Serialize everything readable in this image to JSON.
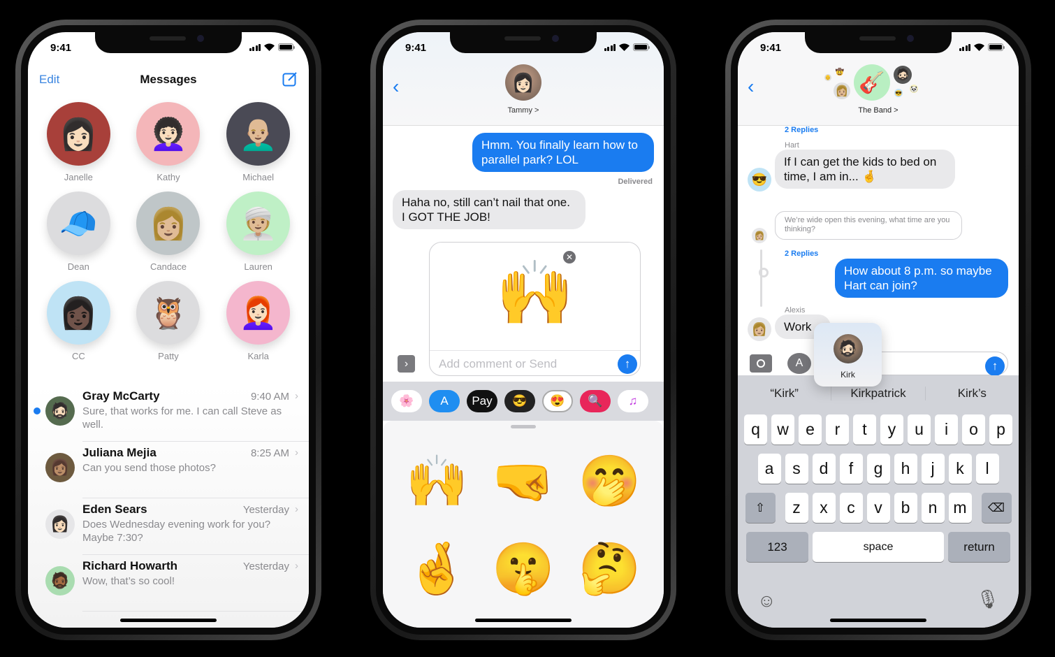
{
  "status_time": "9:41",
  "phone1": {
    "nav": {
      "edit": "Edit",
      "title": "Messages"
    },
    "pinned": [
      {
        "name": "Janelle",
        "icon": "👩🏻",
        "bg": "#a8403a"
      },
      {
        "name": "Kathy",
        "icon": "👩🏻‍🦱",
        "bg": "#f4b6b9"
      },
      {
        "name": "Michael",
        "icon": "👨🏼‍🦲",
        "bg": "#4a4a55"
      },
      {
        "name": "Dean",
        "icon": "🧢",
        "bg": "#dcdcde"
      },
      {
        "name": "Candace",
        "icon": "👩🏼",
        "bg": "#bfc6c8"
      },
      {
        "name": "Lauren",
        "icon": "👳🏼‍♀️",
        "bg": "#bff0c6"
      },
      {
        "name": "CC",
        "icon": "👩🏿",
        "bg": "#bfe3f5"
      },
      {
        "name": "Patty",
        "icon": "🦉",
        "bg": "#dcdcde"
      },
      {
        "name": "Karla",
        "icon": "👩🏻‍🦰",
        "bg": "#f4b6cd"
      }
    ],
    "conversations": [
      {
        "name": "Gray McCarty",
        "time": "9:40 AM",
        "preview": "Sure, that works for me. I can call Steve as well.",
        "unread": true,
        "icon": "🧔🏻",
        "bg": "#556b4f"
      },
      {
        "name": "Juliana Mejia",
        "time": "8:25 AM",
        "preview": "Can you send those photos?",
        "unread": false,
        "icon": "👩🏽",
        "bg": "#6d5a3f"
      },
      {
        "name": "Eden Sears",
        "time": "Yesterday",
        "preview": "Does Wednesday evening work for you? Maybe 7:30?",
        "unread": false,
        "icon": "👩🏻",
        "bg": "#e6e6e8"
      },
      {
        "name": "Richard Howarth",
        "time": "Yesterday",
        "preview": "Wow, that’s so cool!",
        "unread": false,
        "icon": "🧔🏾",
        "bg": "#a9dcb0"
      }
    ]
  },
  "phone2": {
    "contact": "Tammy >",
    "contact_icon": "👩🏻",
    "messages": [
      {
        "dir": "out",
        "text": "Hmm. You finally learn how to parallel park? LOL"
      },
      {
        "dir": "in",
        "text": "Haha no, still can’t nail that one. I GOT THE JOB!"
      }
    ],
    "delivered": "Delivered",
    "draft": {
      "sticker": "🙌",
      "placeholder": "Add comment or Send"
    },
    "apps": [
      {
        "name": "photos",
        "glyph": "🌸",
        "bg": "#ffffff"
      },
      {
        "name": "app-store",
        "glyph": "A",
        "bg": "#1f8ef1"
      },
      {
        "name": "apple-pay",
        "glyph": "Pay",
        "bg": "#111111"
      },
      {
        "name": "memoji",
        "glyph": "😎",
        "bg": "#222222"
      },
      {
        "name": "memoji-stickers",
        "glyph": "😍",
        "bg": "#ffffff"
      },
      {
        "name": "images-search",
        "glyph": "🔍",
        "bg": "#e8265a"
      },
      {
        "name": "music",
        "glyph": "♫",
        "bg": "#ffffff"
      }
    ],
    "stickers": [
      "🙌",
      "🤜",
      "🤭",
      "🤞",
      "🤫",
      "🤔"
    ]
  },
  "phone3": {
    "group": "The Band >",
    "replies_label": "2 Replies",
    "hart": {
      "sender": "Hart",
      "text": "If I can get the kids to bed on time, I am in... 🤞",
      "icon": "😎"
    },
    "quoted": "We’re wide open this evening, what time are you thinking?",
    "out_msg": "How about 8 p.m. so maybe Hart can join?",
    "alexis": {
      "sender": "Alexis",
      "text": "Work",
      "icon": "👩🏼"
    },
    "mention": {
      "name": "Kirk",
      "icon": "🧔🏻"
    },
    "input_value": "Kirk",
    "suggestions": [
      "“Kirk”",
      "Kirkpatrick",
      "Kirk’s"
    ],
    "keys_row1": [
      "q",
      "w",
      "e",
      "r",
      "t",
      "y",
      "u",
      "i",
      "o",
      "p"
    ],
    "keys_row2": [
      "a",
      "s",
      "d",
      "f",
      "g",
      "h",
      "j",
      "k",
      "l"
    ],
    "keys_row3": [
      "z",
      "x",
      "c",
      "v",
      "b",
      "n",
      "m"
    ],
    "key_123": "123",
    "key_space": "space",
    "key_return": "return"
  }
}
